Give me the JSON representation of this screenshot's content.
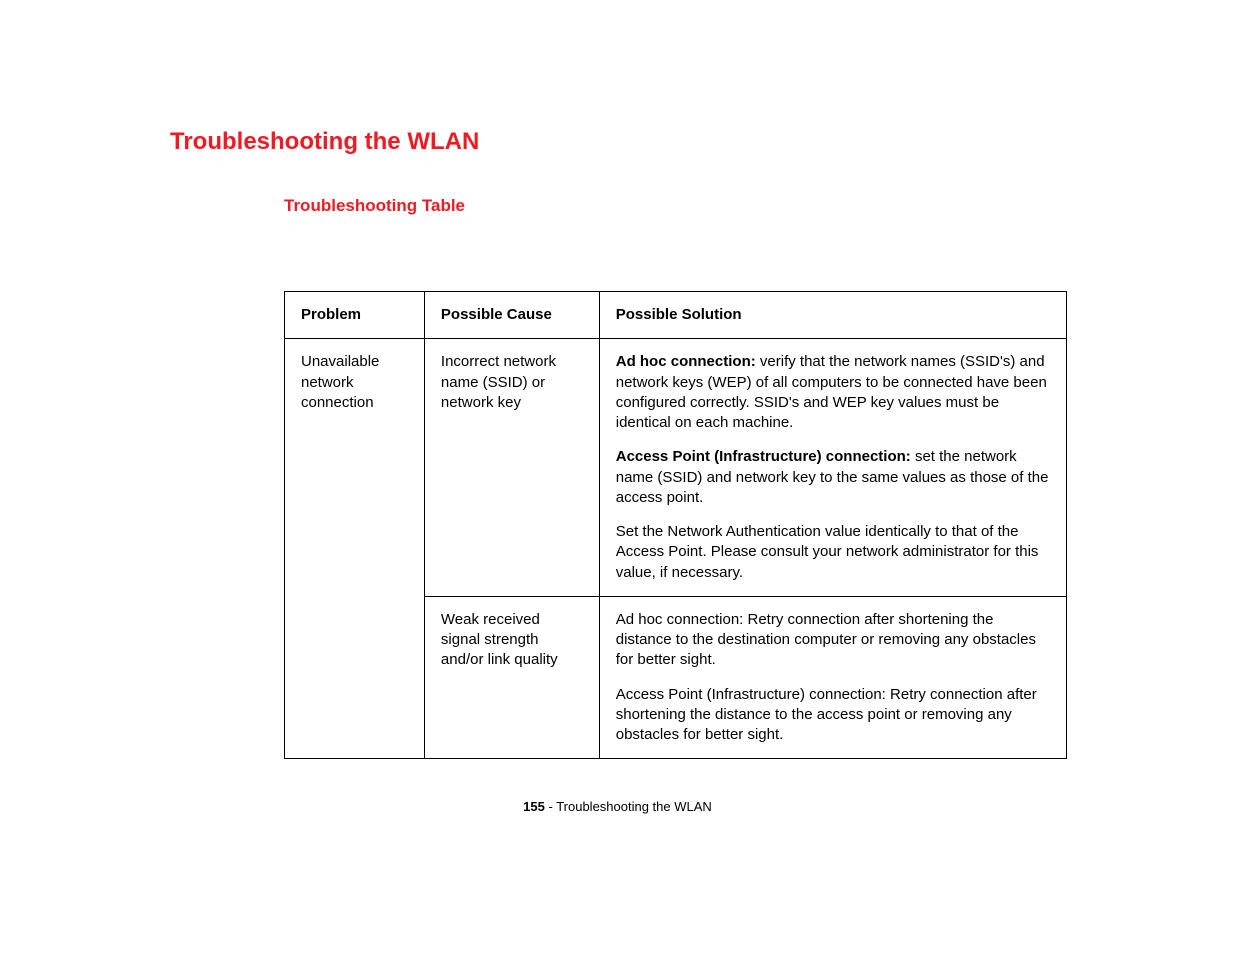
{
  "heading": "Troubleshooting the WLAN",
  "subheading": "Troubleshooting Table",
  "table": {
    "headers": {
      "problem": "Problem",
      "cause": "Possible Cause",
      "solution": "Possible Solution"
    },
    "rows": {
      "problem": "Unavailable network connection",
      "cause1": "Incorrect network name (SSID) or network key",
      "solution1a_label": "Ad hoc connection: ",
      "solution1a_text": "verify that the network names (SSID's) and network keys (WEP) of all computers to be connected have been configured correctly. SSID's and WEP key values must be identical on each machine.",
      "solution1b_label": "Access Point (Infrastructure) connection: ",
      "solution1b_text": "set the network name (SSID) and network key to the same values as those of the access point.",
      "solution1c_text": "Set the Network Authentication value identically to that of the Access Point. Please consult your network administrator for this value, if necessary.",
      "cause2": "Weak received signal strength and/or link quality",
      "solution2a_text": "Ad hoc connection: Retry connection after shortening the distance to the destination computer or removing any obstacles for better sight.",
      "solution2b_text": "Access Point (Infrastructure) connection: Retry connection after shortening the distance to the access point or removing any obstacles for better sight."
    }
  },
  "footer": {
    "page": "155",
    "separator": " - ",
    "title": "Troubleshooting the WLAN"
  }
}
